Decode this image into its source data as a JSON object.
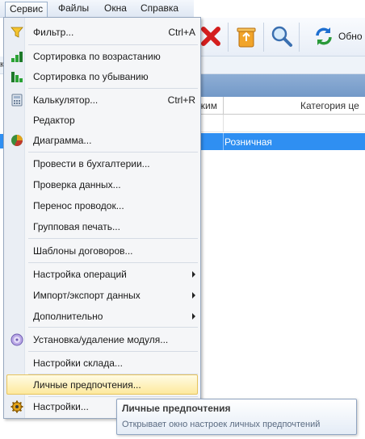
{
  "menubar": {
    "items": [
      "Сервис",
      "Файлы",
      "Окна",
      "Справка"
    ],
    "active": "Сервис"
  },
  "toolbar": {
    "icons": [
      "delete-icon",
      "recycle-bin-icon",
      "search-icon",
      "refresh-icon"
    ],
    "refresh_label": "Обно"
  },
  "left_strip_char": "к",
  "grid": {
    "col1_header": "жим",
    "col2_header": "Категория це",
    "selected_row_value": "Розничная"
  },
  "menu": {
    "items": [
      {
        "label": "Фильтр...",
        "shortcut": "Ctrl+A",
        "icon": "filter-icon"
      },
      {
        "label": "Сортировка по возрастанию",
        "icon": "sort-ascending-icon"
      },
      {
        "label": "Сортировка по убыванию",
        "icon": "sort-descending-icon"
      },
      {
        "label": "Калькулятор...",
        "shortcut": "Ctrl+R",
        "icon": "calculator-icon"
      },
      {
        "label": "Редактор"
      },
      {
        "label": "Диаграмма...",
        "icon": "pie-chart-icon"
      },
      {
        "label": "Провести в бухгалтерии..."
      },
      {
        "label": "Проверка данных..."
      },
      {
        "label": "Перенос проводок..."
      },
      {
        "label": "Групповая печать..."
      },
      {
        "label": "Шаблоны договоров..."
      },
      {
        "label": "Настройка операций",
        "submenu": true
      },
      {
        "label": "Импорт/экспорт данных",
        "submenu": true
      },
      {
        "label": "Дополнительно",
        "submenu": true
      },
      {
        "label": "Установка/удаление модуля...",
        "icon": "disc-icon"
      },
      {
        "label": "Настройки склада..."
      },
      {
        "label": "Личные предпочтения...",
        "highlighted": true
      },
      {
        "label": "Настройки...",
        "icon": "settings-gear-icon"
      }
    ]
  },
  "tooltip": {
    "title": "Личные предпочтения",
    "description": "Открывает окно настроек личных предпочтений"
  },
  "colors": {
    "selection": "#2f8ff2",
    "menu_hover": "#fde99d",
    "panel_header": "#7f9fcc"
  }
}
